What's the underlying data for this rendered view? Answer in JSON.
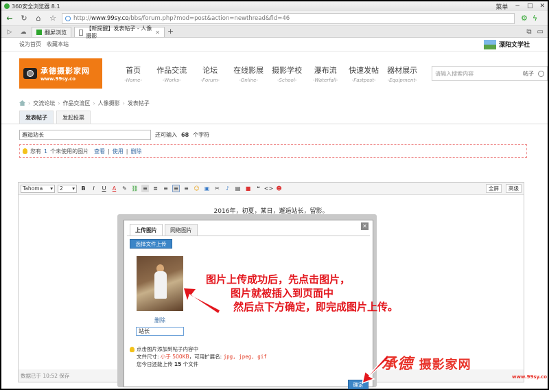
{
  "browser": {
    "title": "360安全浏览器 8.1",
    "menu_label": "菜单",
    "url_host": "www.99sy.co",
    "url_prefix": "http://",
    "url_path": "/bbs/forum.php?mod=post&action=newthread&fid=46",
    "tabs": [
      {
        "label": "翻屏浏览"
      },
      {
        "label": "【新提醒】发表帖子 - 人像摄影"
      }
    ]
  },
  "site": {
    "top_links": [
      "设为首页",
      "收藏本站"
    ],
    "partner_brand": "溧阳文学社",
    "logo_cn": "承德摄影家网",
    "logo_url": "www.99sy.co",
    "nav": [
      {
        "zh": "首页",
        "en": "-Home-"
      },
      {
        "zh": "作品交流",
        "en": "-Works-"
      },
      {
        "zh": "论坛",
        "en": "-Forum-"
      },
      {
        "zh": "在线影展",
        "en": "-Online-"
      },
      {
        "zh": "摄影学校",
        "en": "-School-"
      },
      {
        "zh": "瀑布流",
        "en": "-Waterfall-"
      },
      {
        "zh": "快速发帖",
        "en": "-Fastpost-"
      },
      {
        "zh": "器材展示",
        "en": "-Equipment-"
      }
    ],
    "search_placeholder": "请输入搜索内容",
    "search_scope": "帖子"
  },
  "breadcrumb": [
    "交流论坛",
    "作品交流区",
    "人像摄影",
    "发表帖子"
  ],
  "post_tabs": [
    "发表帖子",
    "发起投票"
  ],
  "subject": {
    "value": "邂逅站长",
    "hint_pre": "还可输入",
    "remaining": "68",
    "hint_post": "个字符"
  },
  "notice": {
    "text_pre": "您有",
    "count": "1",
    "text_post": "个未使用的图片",
    "actions": [
      "查看",
      "使用",
      "删除"
    ]
  },
  "editor": {
    "font": "Tahoma",
    "size": "2",
    "right_buttons": [
      "全屏",
      "高级"
    ],
    "content": "2016年，初夏，某日，邂逅站长，留影。",
    "save_status": "数据已于 10:52 保存"
  },
  "dialog": {
    "tabs": [
      "上传图片",
      "网络图片"
    ],
    "upload_button": "选择文件上传",
    "delete_link": "删除",
    "caption": "站长",
    "tip_line1": "点击图片添加到帖子内容中",
    "tip_size_label": "文件尺寸:",
    "tip_size_value": "小于 500KB",
    "tip_ext_label": "，可用扩展名:",
    "tip_ext_value": "jpg, jpeg, gif",
    "tip_count_pre": "您今日还能上传",
    "tip_count": "15",
    "tip_count_post": "个文件",
    "ok_button": "确定"
  },
  "annotation": {
    "line1": "图片上传成功后，先点击图片，",
    "line2": "图片就被插入到页面中",
    "line3": "然后点下方确定，即完成图片上传。"
  },
  "watermark": {
    "script": "承德",
    "label": "摄影家网",
    "url": "www.99sy.co"
  },
  "colors": {
    "logo_bg": "#f07a14",
    "annotation_red": "#e3161d",
    "button_blue": "#3b85c7"
  }
}
